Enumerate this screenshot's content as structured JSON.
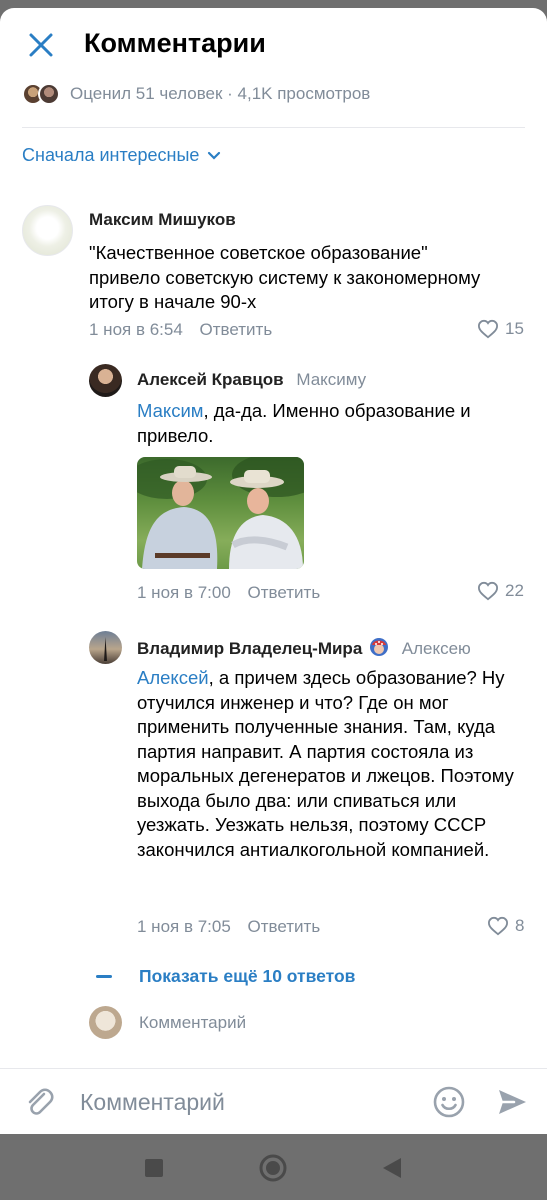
{
  "header": {
    "title": "Комментарии",
    "close_icon": "close-icon"
  },
  "stats": {
    "text": "Оценил 51 человек · 4,1K просмотров"
  },
  "sort": {
    "label": "Сначала интересные"
  },
  "comments": [
    {
      "author": "Максим Мишуков",
      "reply_to": "",
      "mention": "",
      "text": "\"Качественное советское образование\" привело советскую систему к закономерному итогу в начале 90-х",
      "date": "1 ноя в 6:54",
      "reply_label": "Ответить",
      "likes": "15"
    },
    {
      "author": "Алексей Кравцов",
      "reply_to": "Максиму",
      "mention": "Максим",
      "text": ", да-да. Именно образование и привело.",
      "date": "1 ноя в 7:00",
      "reply_label": "Ответить",
      "likes": "22"
    },
    {
      "author": "Владимир Владелец-Мира",
      "reply_to": "Алексею",
      "mention": "Алексей",
      "text": ", а причем здесь образование? Ну отучился инженер и что? Где он мог применить полученные знания. Там, куда партия направит. А партия состояла из моральных дегенератов и лжецов. Поэтому выхода было два: или спиваться или уезжать. Уезжать нельзя, поэтому СССР закончился антиалкогольной компанией.",
      "date": "1 ноя в 7:05",
      "reply_label": "Ответить",
      "likes": "8"
    }
  ],
  "show_more": {
    "label": "Показать ещё 10 ответов"
  },
  "mini_comment": {
    "placeholder": "Комментарий"
  },
  "input": {
    "placeholder": "Комментарий"
  },
  "colors": {
    "accent": "#2a7ec4",
    "secondary": "#818c99",
    "text": "#000000"
  }
}
